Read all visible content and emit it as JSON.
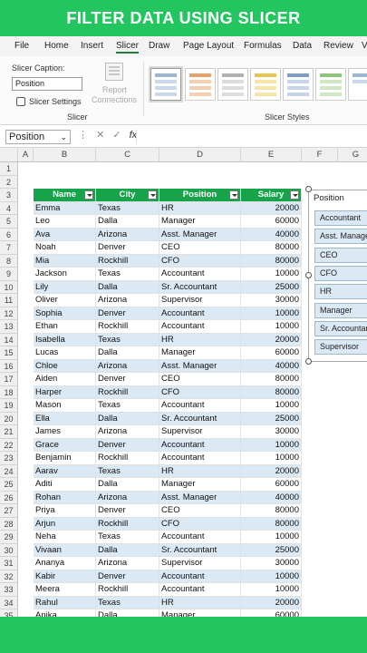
{
  "banner": {
    "title": "FILTER DATA USING SLICER"
  },
  "menu": {
    "items": [
      "File",
      "Home",
      "Insert",
      "Slicer",
      "Draw",
      "Page Layout",
      "Formulas",
      "Data",
      "Review",
      "V"
    ],
    "active": "Slicer"
  },
  "ribbon": {
    "caption_label": "Slicer Caption:",
    "caption_value": "Position",
    "settings_label": "Slicer Settings",
    "report_label_1": "Report",
    "report_label_2": "Connections",
    "group_slicer": "Slicer",
    "group_styles": "Slicer Styles"
  },
  "formula_bar": {
    "name_box": "Position",
    "fx": "fx"
  },
  "columns": [
    "A",
    "B",
    "C",
    "D",
    "E",
    "F",
    "G"
  ],
  "table": {
    "headers": [
      "Name",
      "City",
      "Position",
      "Salary"
    ],
    "rows": [
      [
        "Emma",
        "Texas",
        "HR",
        "20000"
      ],
      [
        "Leo",
        "Dalla",
        "Manager",
        "60000"
      ],
      [
        "Ava",
        "Arizona",
        "Asst. Manager",
        "40000"
      ],
      [
        "Noah",
        "Denver",
        "CEO",
        "80000"
      ],
      [
        "Mia",
        "Rockhill",
        "CFO",
        "80000"
      ],
      [
        "Jackson",
        "Texas",
        "Accountant",
        "10000"
      ],
      [
        "Lily",
        "Dalla",
        "Sr. Accountant",
        "25000"
      ],
      [
        "Oliver",
        "Arizona",
        "Supervisor",
        "30000"
      ],
      [
        "Sophia",
        "Denver",
        "Accountant",
        "10000"
      ],
      [
        "Ethan",
        "Rockhill",
        "Accountant",
        "10000"
      ],
      [
        "Isabella",
        "Texas",
        "HR",
        "20000"
      ],
      [
        "Lucas",
        "Dalla",
        "Manager",
        "60000"
      ],
      [
        "Chloe",
        "Arizona",
        "Asst. Manager",
        "40000"
      ],
      [
        "Aiden",
        "Denver",
        "CEO",
        "80000"
      ],
      [
        "Harper",
        "Rockhill",
        "CFO",
        "80000"
      ],
      [
        "Mason",
        "Texas",
        "Accountant",
        "10000"
      ],
      [
        "Ella",
        "Dalla",
        "Sr. Accountant",
        "25000"
      ],
      [
        "James",
        "Arizona",
        "Supervisor",
        "30000"
      ],
      [
        "Grace",
        "Denver",
        "Accountant",
        "10000"
      ],
      [
        "Benjamin",
        "Rockhill",
        "Accountant",
        "10000"
      ],
      [
        "Aarav",
        "Texas",
        "HR",
        "20000"
      ],
      [
        "Aditi",
        "Dalla",
        "Manager",
        "60000"
      ],
      [
        "Rohan",
        "Arizona",
        "Asst. Manager",
        "40000"
      ],
      [
        "Priya",
        "Denver",
        "CEO",
        "80000"
      ],
      [
        "Arjun",
        "Rockhill",
        "CFO",
        "80000"
      ],
      [
        "Neha",
        "Texas",
        "Accountant",
        "10000"
      ],
      [
        "Vivaan",
        "Dalla",
        "Sr. Accountant",
        "25000"
      ],
      [
        "Ananya",
        "Arizona",
        "Supervisor",
        "30000"
      ],
      [
        "Kabir",
        "Denver",
        "Accountant",
        "10000"
      ],
      [
        "Meera",
        "Rockhill",
        "Accountant",
        "10000"
      ],
      [
        "Rahul",
        "Texas",
        "HR",
        "20000"
      ],
      [
        "Anika",
        "Dalla",
        "Manager",
        "60000"
      ]
    ]
  },
  "slicer": {
    "title": "Position",
    "items": [
      "Accountant",
      "Asst. Manager",
      "CEO",
      "CFO",
      "HR",
      "Manager",
      "Sr. Accountant",
      "Supervisor"
    ]
  },
  "colors": {
    "accent": "#22c55e",
    "header_green": "#16a34a",
    "band": "#dbe9f5"
  }
}
